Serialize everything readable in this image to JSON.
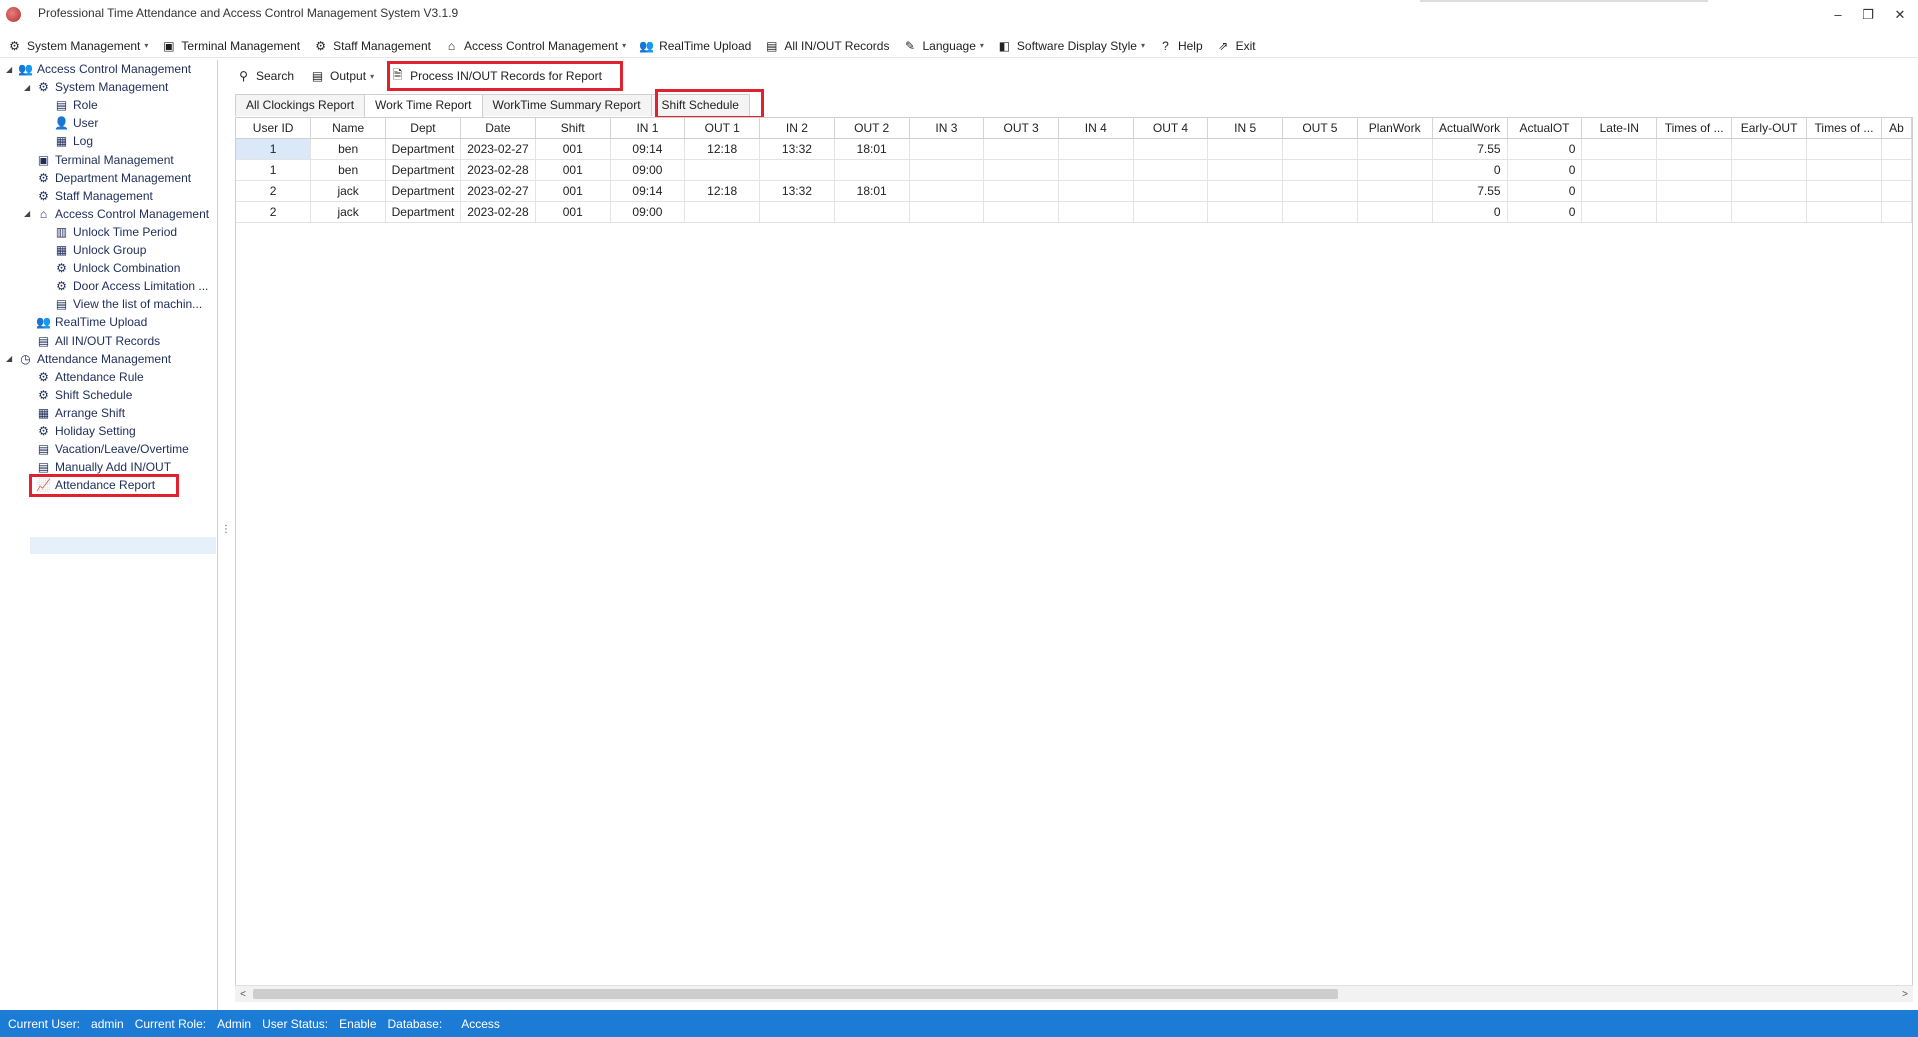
{
  "window": {
    "title": "Professional Time Attendance and Access Control Management System V3.1.9",
    "controls": {
      "minimize": "–",
      "restore": "❐",
      "close": "✕"
    }
  },
  "menu": [
    {
      "label": "System Management",
      "icon": "gear-icon",
      "glyph": "⚙",
      "dropdown": true
    },
    {
      "label": "Terminal Management",
      "icon": "box-icon",
      "glyph": "▣",
      "dropdown": false
    },
    {
      "label": "Staff Management",
      "icon": "gear-icon",
      "glyph": "⚙",
      "dropdown": false
    },
    {
      "label": "Access Control Management",
      "icon": "home-icon",
      "glyph": "⌂",
      "dropdown": true
    },
    {
      "label": "RealTime Upload",
      "icon": "group-icon",
      "glyph": "👥",
      "dropdown": false
    },
    {
      "label": "All IN/OUT Records",
      "icon": "list-icon",
      "glyph": "▤",
      "dropdown": false
    },
    {
      "label": "Language",
      "icon": "language-icon",
      "glyph": "✎",
      "dropdown": true
    },
    {
      "label": "Software Display Style",
      "icon": "style-icon",
      "glyph": "◧",
      "dropdown": true
    },
    {
      "label": "Help",
      "icon": "help-icon",
      "glyph": "?",
      "dropdown": false
    },
    {
      "label": "Exit",
      "icon": "exit-icon",
      "glyph": "⇗",
      "dropdown": false
    }
  ],
  "tree": [
    {
      "label": "Access Control Management",
      "level": 0,
      "toggle": "◢",
      "icon": "users-icon",
      "glyph": "👥",
      "name": "tree-access-control-root"
    },
    {
      "label": "System Management",
      "level": 1,
      "toggle": "◢",
      "icon": "gear-icon",
      "glyph": "⚙",
      "name": "tree-system-management"
    },
    {
      "label": "Role",
      "level": 2,
      "toggle": "",
      "icon": "document-icon",
      "glyph": "▤",
      "name": "tree-role"
    },
    {
      "label": "User",
      "level": 2,
      "toggle": "",
      "icon": "user-icon",
      "glyph": "👤",
      "name": "tree-user"
    },
    {
      "label": "Log",
      "level": 2,
      "toggle": "",
      "icon": "log-icon",
      "glyph": "▦",
      "name": "tree-log"
    },
    {
      "label": "Terminal Management",
      "level": 1,
      "toggle": "",
      "icon": "box-icon",
      "glyph": "▣",
      "name": "tree-terminal-management"
    },
    {
      "label": "Department Management",
      "level": 1,
      "toggle": "",
      "icon": "gear-icon",
      "glyph": "⚙",
      "name": "tree-department-management"
    },
    {
      "label": "Staff Management",
      "level": 1,
      "toggle": "",
      "icon": "gear-icon",
      "glyph": "⚙",
      "name": "tree-staff-management"
    },
    {
      "label": "Access Control Management",
      "level": 1,
      "toggle": "◢",
      "icon": "home-icon",
      "glyph": "⌂",
      "name": "tree-access-control-management"
    },
    {
      "label": "Unlock Time Period",
      "level": 2,
      "toggle": "",
      "icon": "clock-icon",
      "glyph": "▥",
      "name": "tree-unlock-time-period"
    },
    {
      "label": "Unlock Group",
      "level": 2,
      "toggle": "",
      "icon": "grid-icon",
      "glyph": "▦",
      "name": "tree-unlock-group"
    },
    {
      "label": "Unlock Combination",
      "level": 2,
      "toggle": "",
      "icon": "gear-icon",
      "glyph": "⚙",
      "name": "tree-unlock-combination"
    },
    {
      "label": "Door Access Limitation ...",
      "level": 2,
      "toggle": "",
      "icon": "gear-icon",
      "glyph": "⚙",
      "name": "tree-door-access-limitation"
    },
    {
      "label": "View the list of machin...",
      "level": 2,
      "toggle": "",
      "icon": "document-icon",
      "glyph": "▤",
      "name": "tree-view-machine-list"
    },
    {
      "label": "RealTime Upload",
      "level": 1,
      "toggle": "",
      "icon": "group-icon",
      "glyph": "👥",
      "name": "tree-realtime-upload"
    },
    {
      "label": "All IN/OUT Records",
      "level": 1,
      "toggle": "",
      "icon": "list-icon",
      "glyph": "▤",
      "name": "tree-all-inout-records"
    },
    {
      "label": "Attendance Management",
      "level": 0,
      "toggle": "◢",
      "icon": "clock-icon",
      "glyph": "◷",
      "name": "tree-attendance-management"
    },
    {
      "label": "Attendance Rule",
      "level": 1,
      "toggle": "",
      "icon": "gear-icon",
      "glyph": "⚙",
      "name": "tree-attendance-rule"
    },
    {
      "label": "Shift Schedule",
      "level": 1,
      "toggle": "",
      "icon": "gear-icon",
      "glyph": "⚙",
      "name": "tree-shift-schedule"
    },
    {
      "label": "Arrange Shift",
      "level": 1,
      "toggle": "",
      "icon": "table-icon",
      "glyph": "▦",
      "name": "tree-arrange-shift"
    },
    {
      "label": "Holiday Setting",
      "level": 1,
      "toggle": "",
      "icon": "gear-icon",
      "glyph": "⚙",
      "name": "tree-holiday-setting"
    },
    {
      "label": "Vacation/Leave/Overtime",
      "level": 1,
      "toggle": "",
      "icon": "document-icon",
      "glyph": "▤",
      "name": "tree-vacation-leave-overtime"
    },
    {
      "label": "Manually Add IN/OUT",
      "level": 1,
      "toggle": "",
      "icon": "document-icon",
      "glyph": "▤",
      "name": "tree-manually-add-inout"
    },
    {
      "label": "Attendance Report",
      "level": 1,
      "toggle": "",
      "icon": "report-icon",
      "glyph": "📈",
      "name": "tree-attendance-report"
    }
  ],
  "toolbar": [
    {
      "label": "Search",
      "icon": "search-icon",
      "glyph": "⚲",
      "dropdown": false
    },
    {
      "label": "Output",
      "icon": "export-icon",
      "glyph": "▤",
      "dropdown": true
    },
    {
      "label": "Process IN/OUT Records for Report",
      "icon": "process-icon",
      "glyph": "🗎",
      "dropdown": false
    }
  ],
  "tabs": [
    "All Clockings Report",
    "Work Time Report",
    "WorkTime Summary Report",
    "Shift Schedule"
  ],
  "active_tab": 1,
  "table": {
    "columns": [
      "User ID",
      "Name",
      "Dept",
      "Date",
      "Shift",
      "IN 1",
      "OUT 1",
      "IN 2",
      "OUT 2",
      "IN 3",
      "OUT 3",
      "IN 4",
      "OUT 4",
      "IN 5",
      "OUT 5",
      "PlanWork",
      "ActualWork",
      "ActualOT",
      "Late-IN",
      "Times of ...",
      "Early-OUT",
      "Times of ...",
      "Ab"
    ],
    "rows": [
      [
        "1",
        "ben",
        "Department",
        "2023-02-27",
        "001",
        "09:14",
        "12:18",
        "13:32",
        "18:01",
        "",
        "",
        "",
        "",
        "",
        "",
        "",
        "7.55",
        "0",
        "",
        "",
        "",
        "",
        ""
      ],
      [
        "1",
        "ben",
        "Department",
        "2023-02-28",
        "001",
        "09:00",
        "",
        "",
        "",
        "",
        "",
        "",
        "",
        "",
        "",
        "",
        "0",
        "0",
        "",
        "",
        "",
        "",
        ""
      ],
      [
        "2",
        "jack",
        "Department",
        "2023-02-27",
        "001",
        "09:14",
        "12:18",
        "13:32",
        "18:01",
        "",
        "",
        "",
        "",
        "",
        "",
        "",
        "7.55",
        "0",
        "",
        "",
        "",
        "",
        ""
      ],
      [
        "2",
        "jack",
        "Department",
        "2023-02-28",
        "001",
        "09:00",
        "",
        "",
        "",
        "",
        "",
        "",
        "",
        "",
        "",
        "",
        "0",
        "0",
        "",
        "",
        "",
        "",
        ""
      ]
    ]
  },
  "scrollbar": {
    "left_arrow": "<",
    "right_arrow": ">"
  },
  "statusbar": {
    "user_label": "Current User:",
    "user_value": "admin",
    "role_label": "Current Role:",
    "role_value": "Admin",
    "status_label": "User Status:",
    "status_value": "Enable",
    "db_label": "Database:",
    "db_value": "Access"
  },
  "colors": {
    "statusbar": "#1c7cd5",
    "highlight": "#e0212f",
    "selection": "#dbe8f8"
  }
}
